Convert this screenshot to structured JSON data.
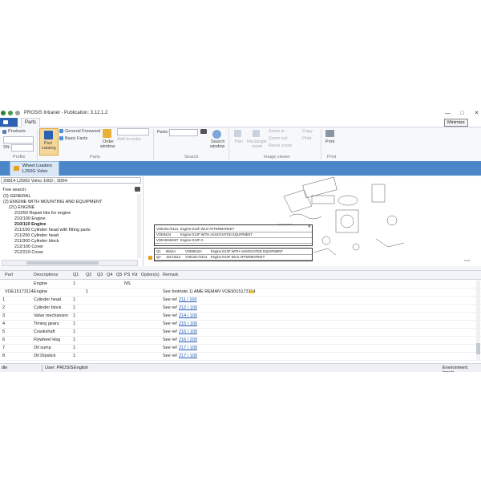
{
  "window": {
    "title": "PROSIS Intranet - Publication: 3.12.1.2",
    "tooltip": "Minimize",
    "min_symbol": "—",
    "max_symbol": "□",
    "close_symbol": "✕"
  },
  "menu": {
    "tab": "Parts"
  },
  "ribbon": {
    "products_label": "Products",
    "sn_label": "SN:",
    "profile_group": "Profile",
    "part_catalog": [
      "Part",
      "catalog"
    ],
    "general_foreword": "General Foreword",
    "basic_facts": "Basic Facts",
    "order_window": [
      "Order",
      "window"
    ],
    "add_to_order": "Add to order",
    "parts_group": "Parts",
    "parts_label": "Parts:",
    "search_window": [
      "Search",
      "window"
    ],
    "search_group": "Search",
    "pan": "Pan",
    "rectangle_zoom": [
      "Rectangle",
      "zoom"
    ],
    "zoom_in": "Zoom in",
    "zoom_out": "Zoom out",
    "reset_zoom": "Reset zoom",
    "copy": "Copy",
    "print_small": "Print",
    "image_viewer_group": "Image viewer",
    "print_big": "Print",
    "print_group": "Print"
  },
  "band": {
    "line1": "Wheel Loaders",
    "line2": "L250G Volvo"
  },
  "left": {
    "combo_value": "20814 L250G Volvo 1002-, 3004-",
    "tree_search_label": "Tree search:",
    "tree": [
      "(2) GENERAL",
      "(2) ENGINE WITH MOUNTING AND EQUIPMENT",
      "(21) ENGINE",
      "210/50 Repair kits for engine",
      "210/100 Engine",
      "210/110 Engine",
      "211/100 Cylinder head with fitting parts",
      "211/200 Cylinder head",
      "211/300 Cylinder block",
      "212/100 Cover",
      "212/210 Cover"
    ]
  },
  "popup_top": [
    [
      "VOE15173114",
      "Engine D13F WLO AFTERMARKET"
    ],
    [
      "VOE8424",
      "Engine D13F WITH ASSOCIATED EQUIPMENT"
    ],
    [
      "VOE15049437",
      "Engine D13F-C"
    ]
  ],
  "popup_bottom": [
    [
      "Q1",
      "8542A",
      "VOE8542A",
      "Engine D13F WITH ASSOCIATED EQUIPMENT"
    ],
    [
      "Q2",
      "15173114",
      "VOE15173114",
      "Engine D13F WLO AFTERMARKET"
    ]
  ],
  "grid": {
    "headers": [
      "Part",
      "Descriptions",
      "Q1",
      "Q2",
      "Q3",
      "Q4",
      "Q5",
      "PS",
      "Kit",
      "Option(s)",
      "Remark"
    ],
    "rows": [
      {
        "num": "",
        "part": "",
        "desc": "Engine",
        "q1": "1",
        "q2": "",
        "ps": "NS",
        "remark": "",
        "ref": ""
      },
      {
        "num": "",
        "part": "VOE15173114",
        "desc": "Engine",
        "q1": "",
        "q2": "1",
        "ps": "",
        "remark": "See footnote 1) AME REMAN VOE9015173114",
        "ref": ""
      },
      {
        "num": "1",
        "part": "",
        "desc": "Cylinder head",
        "q1": "1",
        "q2": "",
        "ps": "",
        "remark": "See ref",
        "ref": "211 / 100"
      },
      {
        "num": "2",
        "part": "",
        "desc": "Cylinder block",
        "q1": "1",
        "q2": "",
        "ps": "",
        "remark": "See ref",
        "ref": "212 / 100"
      },
      {
        "num": "3",
        "part": "",
        "desc": "Valve mechanism",
        "q1": "1",
        "q2": "",
        "ps": "",
        "remark": "See ref",
        "ref": "214 / 100"
      },
      {
        "num": "4",
        "part": "",
        "desc": "Timing gears",
        "q1": "1",
        "q2": "",
        "ps": "",
        "remark": "See ref",
        "ref": "215 / 100"
      },
      {
        "num": "5",
        "part": "",
        "desc": "Crankshaft",
        "q1": "1",
        "q2": "",
        "ps": "",
        "remark": "See ref",
        "ref": "216 / 100"
      },
      {
        "num": "6",
        "part": "",
        "desc": "Flywheel Hsg",
        "q1": "1",
        "q2": "",
        "ps": "",
        "remark": "See ref",
        "ref": "216 / 200"
      },
      {
        "num": "7",
        "part": "",
        "desc": "Oil sump",
        "q1": "1",
        "q2": "",
        "ps": "",
        "remark": "See ref",
        "ref": "217 / 100"
      },
      {
        "num": "8",
        "part": "",
        "desc": "Oil Dipstick",
        "q1": "1",
        "q2": "",
        "ps": "",
        "remark": "See ref",
        "ref": "217 / 100"
      }
    ]
  },
  "status": {
    "left": "dle",
    "user": "User: PROSIS",
    "lang": "English",
    "env": "Environment: prosis"
  },
  "colors": {
    "accent": "#2b62b4",
    "band": "#4b86c9",
    "link": "#1a55b0"
  }
}
